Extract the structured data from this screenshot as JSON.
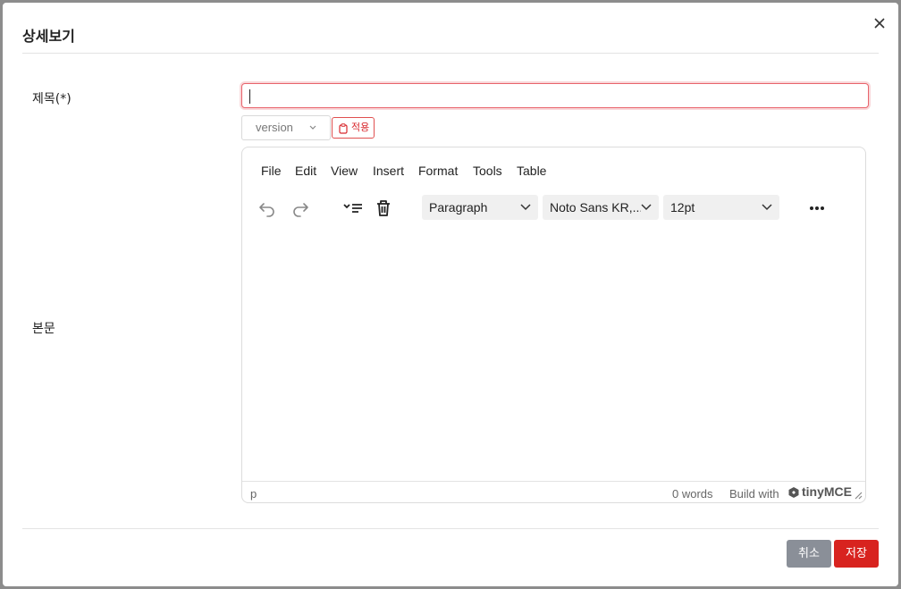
{
  "dialog": {
    "title": "상세보기"
  },
  "form": {
    "title_label": "제목(*)",
    "title_value": "",
    "body_label": "본문"
  },
  "version_select": {
    "selected": "version"
  },
  "apply_button": {
    "label": "적용"
  },
  "editor": {
    "menu": [
      "File",
      "Edit",
      "View",
      "Insert",
      "Format",
      "Tools",
      "Table"
    ],
    "block_format": "Paragraph",
    "font_family": "Noto Sans KR,...",
    "font_size": "12pt",
    "status": {
      "path": "p",
      "word_count": "0 words",
      "branding_prefix": "Build with",
      "branding_name": "tinyMCE"
    }
  },
  "footer": {
    "cancel_label": "취소",
    "save_label": "저장"
  },
  "colors": {
    "accent_red": "#d8231f",
    "cancel_gray": "#8a8f98",
    "focus_border": "#e8636b"
  }
}
